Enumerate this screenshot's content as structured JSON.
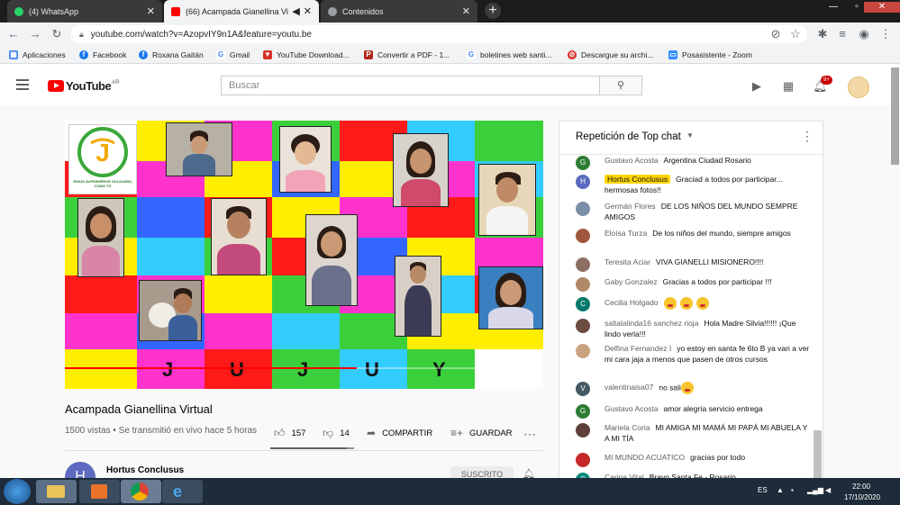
{
  "browser": {
    "tabs": [
      {
        "title": "(4) WhatsApp",
        "favicon_color": "#25d366",
        "active": false
      },
      {
        "title": "(66) Acampada Gianellina Vi",
        "favicon_color": "#ff0000",
        "active": true
      },
      {
        "title": "Contenidos",
        "favicon_color": "#9aa0a6",
        "active": false
      }
    ],
    "url": "youtube.com/watch?v=AzopvIY9n1A&feature=youtu.be",
    "bookmarks": [
      {
        "label": "Aplicaciones",
        "color": "#4285f4",
        "glyph": "▦"
      },
      {
        "label": "Facebook",
        "color": "#1877f2",
        "glyph": "f"
      },
      {
        "label": "Roxana Gaitán",
        "color": "#1877f2",
        "glyph": "f"
      },
      {
        "label": "Gmail",
        "color": "#ea4335",
        "glyph": "G"
      },
      {
        "label": "YouTube Download...",
        "color": "#d93025",
        "glyph": "▼"
      },
      {
        "label": "Convertir a PDF - 1...",
        "color": "#b3261e",
        "glyph": "P"
      },
      {
        "label": "boletines web santi...",
        "color": "#4285f4",
        "glyph": "G"
      },
      {
        "label": "Descargue su archi...",
        "color": "#d93025",
        "glyph": "⊘"
      },
      {
        "label": "Posasistente - Zoom",
        "color": "#2d8cff",
        "glyph": "▭"
      }
    ]
  },
  "youtube": {
    "logo_text": "YouTube",
    "country": "AR",
    "search_placeholder": "Buscar",
    "notification_count": "9+"
  },
  "video": {
    "title": "Acampada Gianellina Virtual",
    "meta": "1500 vistas • Se transmitió en vivo hace 5 horas",
    "likes": "157",
    "dislikes": "14",
    "share_label": "COMPARTIR",
    "save_label": "GUARDAR",
    "banner_letters": [
      "J",
      "U",
      "J",
      "U",
      "Y"
    ],
    "progress_fraction": 0.61,
    "logo_text": "JESÚS SUPERHÉROE SOLIDARIO, COMO TÚ"
  },
  "channel": {
    "name": "Hortus Conclusus",
    "initial": "H",
    "subscribe_label": "SUSCRITO"
  },
  "chat": {
    "title": "Repetición de Top chat",
    "messages": [
      {
        "author": "Gustavo Acosta",
        "text": "Argentina Ciudad Rosario",
        "initial": "G",
        "color": "#2e7d32",
        "highlight": false
      },
      {
        "author": "Hortus Conclusus",
        "text": "Graciad a todos por participar... hermosas fotos!!",
        "initial": "H",
        "color": "#5c6bc0",
        "highlight": true
      },
      {
        "author": "Germán Flores",
        "text": "DE LOS NIÑOS DEL MUNDO SEMPRE AMIGOS",
        "initial": "",
        "color": "#7a8fa6",
        "highlight": false
      },
      {
        "author": "Eloísa Turza",
        "text": "De los niños del mundo, siempre amigos",
        "initial": "",
        "color": "#a0563c",
        "highlight": false
      },
      {
        "author": "Teresita Aciar",
        "text": "VIVA GIANELLI MISIONERO!!!!",
        "initial": "",
        "color": "#8d6e63",
        "highlight": false
      },
      {
        "author": "Gaby Gonzalez",
        "text": "Gracias a todos por participar !!!",
        "initial": "",
        "color": "#b08968",
        "highlight": false
      },
      {
        "author": "Cecilia Holgado",
        "text": "",
        "initial": "C",
        "color": "#00796b",
        "highlight": false,
        "emojis": 3
      },
      {
        "author": "saltalalinda16 sanchez rioja",
        "text": "Hola Madre Silvia!!!!!! ¡Que lindo verla!!!",
        "initial": "",
        "color": "#6d4c41",
        "highlight": false
      },
      {
        "author": "Delfina Fernandez I",
        "text": "yo estoy en santa fe 6to B ya van a ver mi cara jaja a menos que pasen de otros cursos",
        "initial": "",
        "color": "#c9a37f",
        "highlight": false
      },
      {
        "author": "valentinaisa07",
        "text": "no sali",
        "initial": "V",
        "color": "#455a64",
        "highlight": false,
        "emojis": 1
      },
      {
        "author": "Gustavo Acosta",
        "text": "amor alegría servicio entrega",
        "initial": "G",
        "color": "#2e7d32",
        "highlight": false
      },
      {
        "author": "Mariela Coria",
        "text": "MI AMIGA MI MAMÁ MI PAPÁ MI ABUELA Y A MI TÍA",
        "initial": "",
        "color": "#5d4037",
        "highlight": false
      },
      {
        "author": "MI MUNDO ACUATICO",
        "text": "gracias por todo",
        "initial": "",
        "color": "#c62828",
        "highlight": false
      },
      {
        "author": "Carina Vital",
        "text": "Bravo Santa Fe - Rosario",
        "initial": "C",
        "color": "#00897b",
        "highlight": false
      }
    ]
  },
  "taskbar": {
    "language": "ES",
    "time": "22:00",
    "date": "17/10/2020"
  }
}
